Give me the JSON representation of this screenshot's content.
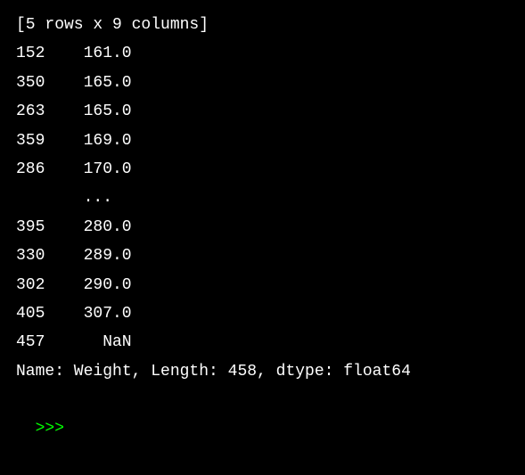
{
  "header": "[5 rows x 9 columns]",
  "rows_top": [
    {
      "idx": "152",
      "val": "161.0"
    },
    {
      "idx": "350",
      "val": "165.0"
    },
    {
      "idx": "263",
      "val": "165.0"
    },
    {
      "idx": "359",
      "val": "169.0"
    },
    {
      "idx": "286",
      "val": "170.0"
    }
  ],
  "ellipsis": "       ...  ",
  "rows_bottom": [
    {
      "idx": "395",
      "val": "280.0"
    },
    {
      "idx": "330",
      "val": "289.0"
    },
    {
      "idx": "302",
      "val": "290.0"
    },
    {
      "idx": "405",
      "val": "307.0"
    },
    {
      "idx": "457",
      "val": "NaN"
    }
  ],
  "footer": "Name: Weight, Length: 458, dtype: float64",
  "prompt": ">>>"
}
